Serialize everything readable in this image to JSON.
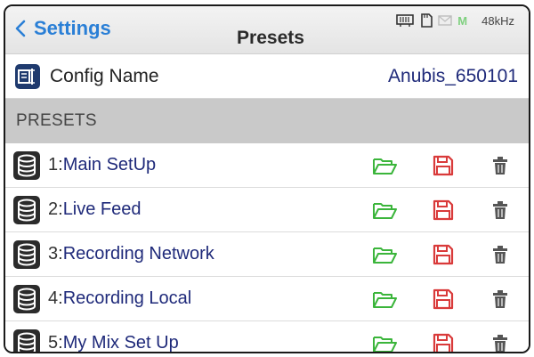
{
  "header": {
    "back_label": "Settings",
    "title": "Presets",
    "status": {
      "m_label": "M",
      "sample_rate": "48kHz"
    }
  },
  "config": {
    "label": "Config Name",
    "value": "Anubis_650101"
  },
  "section": {
    "label": "PRESETS"
  },
  "presets": [
    {
      "number": "1:",
      "name": "Main SetUp"
    },
    {
      "number": "2:",
      "name": "Live Feed"
    },
    {
      "number": "3:",
      "name": "Recording Network"
    },
    {
      "number": "4:",
      "name": "Recording Local"
    },
    {
      "number": "5:",
      "name": "My Mix Set Up"
    }
  ],
  "colors": {
    "accent_blue": "#2a7fd6",
    "name_text": "#1f2a7a",
    "open_green": "#3bb53b",
    "save_red": "#d93a3a",
    "delete_gray": "#555555",
    "status_green": "#7fd07f",
    "section_bg": "#c9c9c9"
  },
  "icons": {
    "back": "chevron-left-icon",
    "config": "config-card-icon",
    "preset": "database-icon",
    "open": "folder-open-icon",
    "save": "floppy-disk-icon",
    "delete": "trash-icon"
  }
}
